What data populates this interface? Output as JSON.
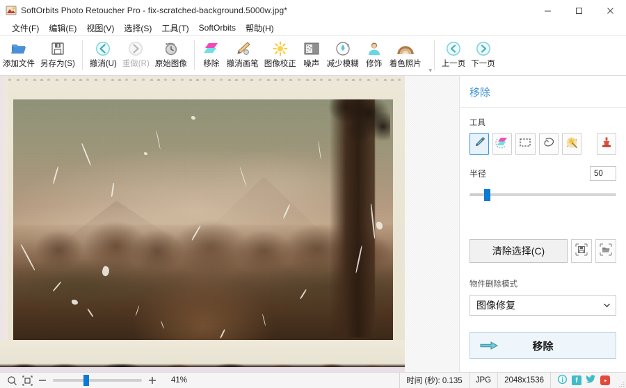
{
  "window": {
    "title": "SoftOrbits Photo Retoucher Pro - fix-scratched-background.5000w.jpg*",
    "app_icon": "app-logo-icon",
    "minimize": "–",
    "maximize": "□",
    "close": "✕"
  },
  "menubar": {
    "items": [
      {
        "label": "文件(F)",
        "name": "menu-file"
      },
      {
        "label": "编辑(E)",
        "name": "menu-edit"
      },
      {
        "label": "视图(V)",
        "name": "menu-view"
      },
      {
        "label": "选择(S)",
        "name": "menu-select"
      },
      {
        "label": "工具(T)",
        "name": "menu-tools"
      },
      {
        "label": "SoftOrbits",
        "name": "menu-softorbits"
      },
      {
        "label": "帮助(H)",
        "name": "menu-help"
      }
    ]
  },
  "toolbar": {
    "groups": [
      {
        "name": "file-group",
        "buttons": [
          {
            "label": "添加文件",
            "icon": "open-folder-icon",
            "disabled": false
          },
          {
            "label": "另存为(S)",
            "icon": "save-disk-icon",
            "disabled": false
          }
        ]
      },
      {
        "name": "history-group",
        "buttons": [
          {
            "label": "撤消(U)",
            "icon": "undo-arrow-icon",
            "disabled": false
          },
          {
            "label": "重做(R)",
            "icon": "redo-arrow-icon",
            "disabled": true
          },
          {
            "label": "原始图像",
            "icon": "clock-revert-icon",
            "disabled": false
          }
        ]
      },
      {
        "name": "effects-group",
        "buttons": [
          {
            "label": "移除",
            "icon": "remove-shapes-icon",
            "disabled": false
          },
          {
            "label": "撤消画笔",
            "icon": "undo-brush-icon",
            "disabled": false
          },
          {
            "label": "图像校正",
            "icon": "brightness-sun-icon",
            "disabled": false
          },
          {
            "label": "噪声",
            "icon": "noise-grid-icon",
            "disabled": false
          },
          {
            "label": "减少模糊",
            "icon": "deblur-drop-icon",
            "disabled": false
          },
          {
            "label": "修饰",
            "icon": "portrait-retouch-icon",
            "disabled": false
          },
          {
            "label": "着色照片",
            "icon": "colorize-rainbow-icon",
            "disabled": false
          }
        ]
      },
      {
        "name": "navigation-group",
        "buttons": [
          {
            "label": "上一页",
            "icon": "prev-page-icon",
            "disabled": false
          },
          {
            "label": "下一页",
            "icon": "next-page-icon",
            "disabled": false
          }
        ]
      }
    ],
    "expand_glyph": "▾"
  },
  "canvas": {
    "image_name": "scratched-vintage-photo",
    "alt": "Old damaged sepia photograph of a misty forest path with a large tree, torn and burnt edges"
  },
  "panel": {
    "title": "移除",
    "tools_label": "工具",
    "tools": [
      {
        "name": "tool-marker",
        "icon": "marker-pen-icon",
        "selected": true
      },
      {
        "name": "tool-brush-erase",
        "icon": "eraser-shapes-icon",
        "selected": false
      },
      {
        "name": "tool-rectangle-select",
        "icon": "rectangle-select-icon",
        "selected": false
      },
      {
        "name": "tool-lasso",
        "icon": "lasso-select-icon",
        "selected": false
      },
      {
        "name": "tool-magic-wand",
        "icon": "magic-wand-icon",
        "selected": false
      },
      {
        "name": "tool-clone-stamp",
        "icon": "clone-stamp-icon",
        "selected": false
      }
    ],
    "radius_label": "半径",
    "radius_value": "50",
    "radius_percent": 10,
    "clear_selection_label": "清除选择(C)",
    "save_selection_icon": "save-selection-icon",
    "load_selection_icon": "load-selection-icon",
    "mode_label": "物件删除模式",
    "mode_value": "图像修复",
    "mode_caret": "▾",
    "remove_button_label": "移除",
    "remove_button_icon": "arrow-right-icon",
    "accent_color": "#3b8fd6"
  },
  "statusbar": {
    "zoom_out_icon": "zoom-magnifier-icon",
    "fit_icon": "fit-to-window-icon",
    "minus": "–",
    "plus": "+",
    "zoom_percent": "41%",
    "zoom_slider_percent": 34,
    "time_label": "时间 (秒): 0.135",
    "format": "JPG",
    "dimensions": "2048x1536",
    "info_icon": "info-icon",
    "facebook_icon": "facebook-icon",
    "twitter_icon": "twitter-icon",
    "youtube_icon": "youtube-icon",
    "resize-grip": "resize-grip-icon"
  }
}
